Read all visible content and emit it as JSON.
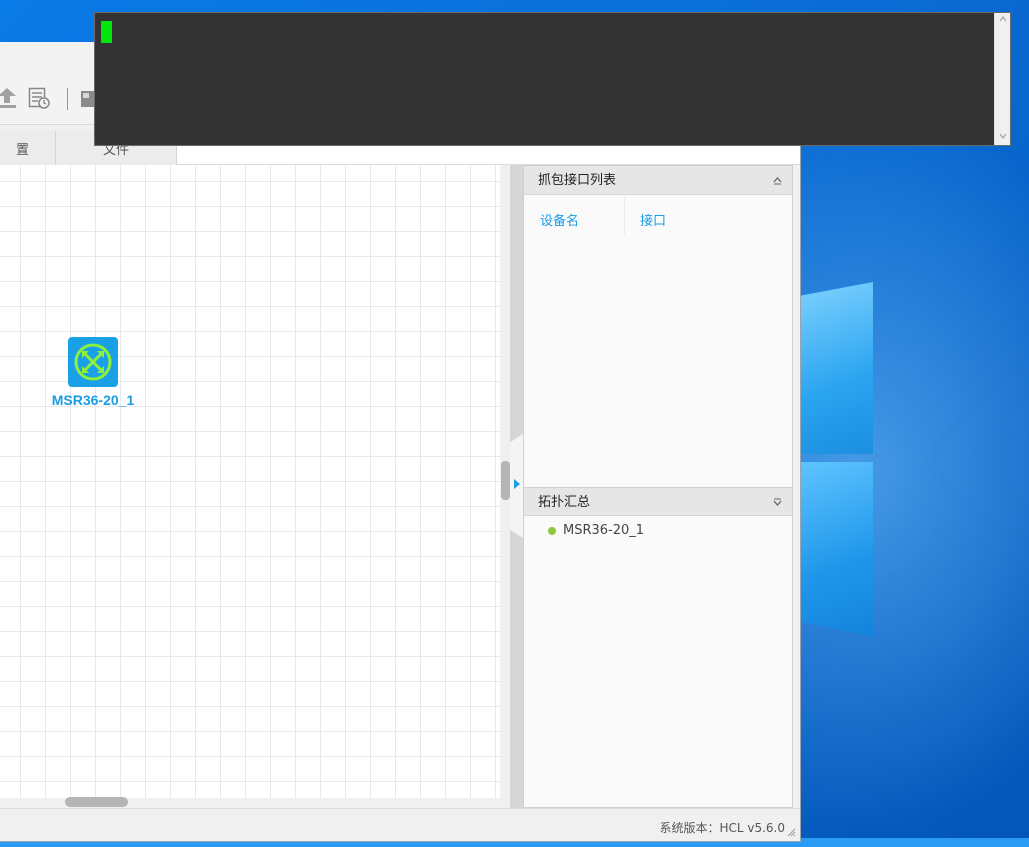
{
  "app": {
    "tabs": [
      {
        "label": "置"
      },
      {
        "label": "文件"
      }
    ],
    "canvas": {
      "device": {
        "name": "MSR36-20_1",
        "icon": "router-icon",
        "icon_bg": "#1aa0e6",
        "icon_fg": "#8cf03c"
      }
    },
    "capture_panel": {
      "title": "抓包接口列表",
      "columns": [
        "设备名",
        "接口"
      ]
    },
    "summary_panel": {
      "title": "拓扑汇总",
      "items": [
        {
          "name": "MSR36-20_1",
          "status_color": "#8dc63f"
        }
      ]
    },
    "statusbar": {
      "version": "系统版本：HCL v5.6.0"
    }
  },
  "console": {
    "cursor_color": "#00e60a",
    "background": "#333333"
  },
  "colors": {
    "accent": "#1a9ce6"
  }
}
